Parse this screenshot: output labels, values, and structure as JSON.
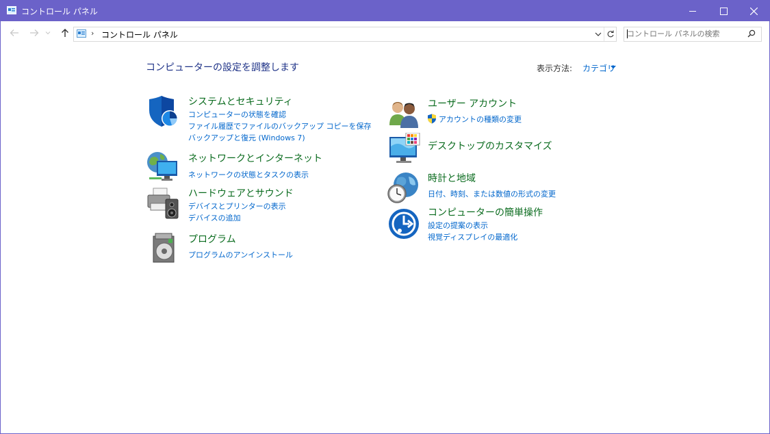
{
  "window": {
    "title": "コントロール パネル"
  },
  "address_bar": {
    "breadcrumb": "コントロール パネル",
    "separator": "›"
  },
  "search": {
    "placeholder": "コントロール パネルの検索"
  },
  "main": {
    "heading": "コンピューターの設定を調整します",
    "view_by_label": "表示方法:",
    "view_by_value": "カテゴリ"
  },
  "categories": {
    "system_security": {
      "icon": "shield-pie-icon",
      "title": "システムとセキュリティ",
      "links": [
        "コンピューターの状態を確認",
        "ファイル履歴でファイルのバックアップ コピーを保存",
        "バックアップと復元 (Windows 7)"
      ]
    },
    "network": {
      "icon": "network-globe-icon",
      "title": "ネットワークとインターネット",
      "links": [
        "ネットワークの状態とタスクの表示"
      ]
    },
    "hardware_sound": {
      "icon": "printer-speaker-icon",
      "title": "ハードウェアとサウンド",
      "links": [
        "デバイスとプリンターの表示",
        "デバイスの追加"
      ]
    },
    "programs": {
      "icon": "programs-disc-icon",
      "title": "プログラム",
      "links": [
        "プログラムのアンインストール"
      ]
    },
    "user_accounts": {
      "icon": "users-icon",
      "title": "ユーザー アカウント",
      "links": [
        "アカウントの種類の変更"
      ]
    },
    "appearance": {
      "icon": "monitor-palette-icon",
      "title": "デスクトップのカスタマイズ",
      "links": []
    },
    "clock_region": {
      "icon": "globe-clock-icon",
      "title": "時計と地域",
      "links": [
        "日付、時刻、または数値の形式の変更"
      ]
    },
    "ease_of_access": {
      "icon": "ease-of-access-icon",
      "title": "コンピューターの簡単操作",
      "links": [
        "設定の提案の表示",
        "視覚ディスプレイの最適化"
      ]
    }
  },
  "colors": {
    "titlebar": "#6b62c9",
    "heading": "#1e3287",
    "category_title": "#0a6b1e",
    "link": "#0066cc"
  }
}
